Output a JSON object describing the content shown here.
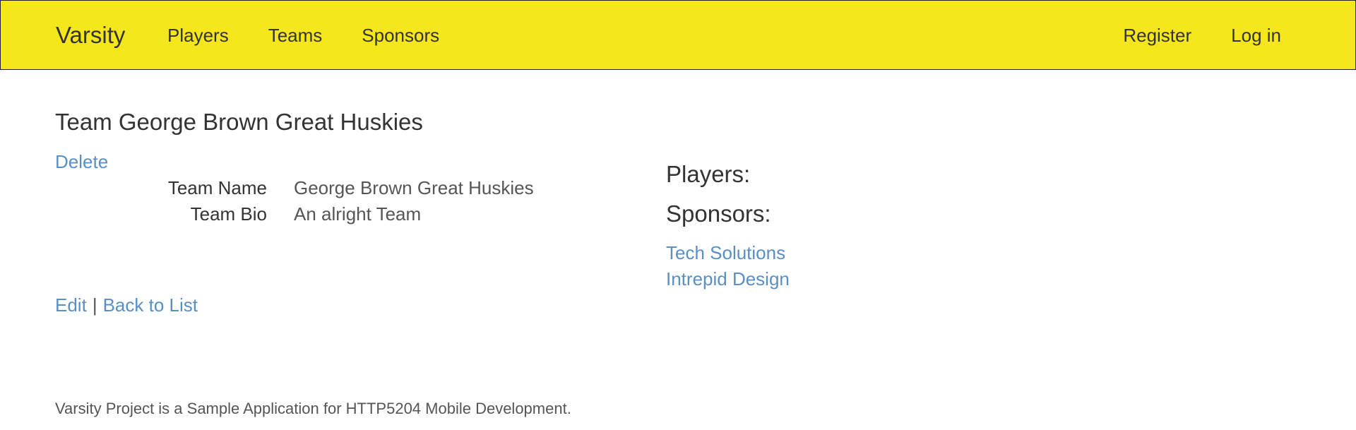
{
  "navbar": {
    "brand": "Varsity",
    "left_links": [
      "Players",
      "Teams",
      "Sponsors"
    ],
    "right_links": [
      "Register",
      "Log in"
    ],
    "background": "#f5e71c"
  },
  "main": {
    "title": "Team George Brown Great Huskies",
    "delete_label": "Delete",
    "details": [
      {
        "label": "Team Name",
        "value": "George Brown Great Huskies"
      },
      {
        "label": "Team Bio",
        "value": "An alright Team"
      }
    ],
    "edit_label": "Edit",
    "separator": "|",
    "back_label": "Back to List"
  },
  "right": {
    "players_heading": "Players:",
    "sponsors_heading": "Sponsors:",
    "sponsors": [
      "Tech Solutions",
      "Intrepid Design"
    ]
  },
  "footer": {
    "text": "Varsity Project is a Sample Application for HTTP5204 Mobile Development."
  },
  "colors": {
    "link": "#5a8fc4",
    "text": "#333333"
  }
}
